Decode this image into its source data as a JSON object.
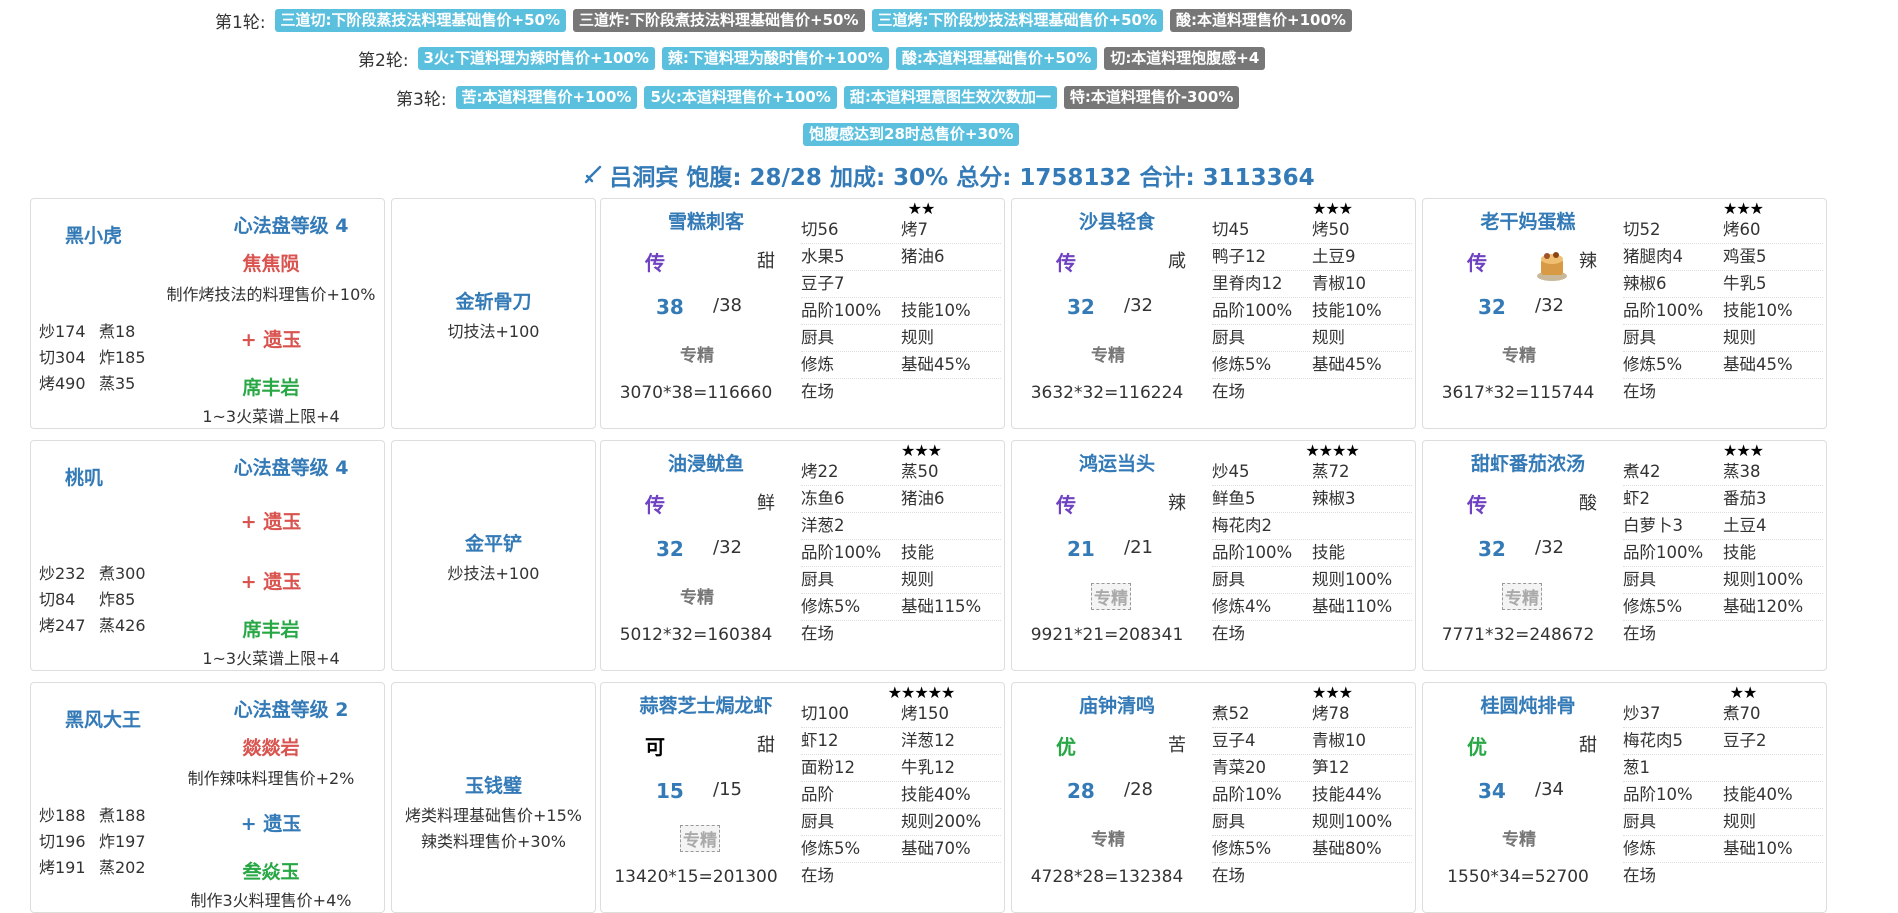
{
  "rounds": [
    {
      "title": "第1轮:",
      "buffs": [
        {
          "text": "三道切:下阶段蒸技法料理基础售价+50%",
          "color": "blue"
        },
        {
          "text": "三道炸:下阶段煮技法料理基础售价+50%",
          "color": "gray"
        },
        {
          "text": "三道烤:下阶段炒技法料理基础售价+50%",
          "color": "blue"
        },
        {
          "text": "酸:本道料理售价+100%",
          "color": "gray"
        }
      ]
    },
    {
      "title": "第2轮:",
      "buffs": [
        {
          "text": "3火:下道料理为辣时售价+100%",
          "color": "blue"
        },
        {
          "text": "辣:下道料理为酸时售价+100%",
          "color": "blue"
        },
        {
          "text": "酸:本道料理基础售价+50%",
          "color": "blue"
        },
        {
          "text": "切:本道料理饱腹感+4",
          "color": "gray"
        }
      ]
    },
    {
      "title": "第3轮:",
      "buffs": [
        {
          "text": "苦:本道料理售价+100%",
          "color": "blue"
        },
        {
          "text": "5火:本道料理售价+100%",
          "color": "blue"
        },
        {
          "text": "甜:本道料理意图生效次数加一",
          "color": "blue"
        },
        {
          "text": "特:本道料理售价-300%",
          "color": "gray"
        }
      ]
    }
  ],
  "extra_buff": "饱腹感达到28时总售价+30%",
  "summary": {
    "icon": "sword-icon",
    "text": "吕洞宾 饱腹: 28/28 加成: 30% 总分: 1758132 合计: 3113364"
  },
  "rows": [
    {
      "chef": {
        "name": "黑小虎",
        "disk": "心法盘等级 4",
        "jade1": "焦焦陨",
        "jade1_desc": "制作烤技法的料理售价+10%",
        "jade2": "+ 遗玉",
        "jade3": "席丰岩",
        "jade3_desc": "1~3火菜谱上限+4",
        "stats": [
          [
            "炒174",
            "煮18"
          ],
          [
            "切304",
            "炸185"
          ],
          [
            "烤490",
            "蒸35"
          ]
        ]
      },
      "equip": {
        "name": "金斩骨刀",
        "skills": [
          "切技法+100"
        ]
      },
      "dishes": [
        {
          "name": "雪糕刺客",
          "rank": "传",
          "rank_color": "purple",
          "taste": "甜",
          "qty": "38",
          "qtymax": "/38",
          "spec": "专精",
          "spec_faded": false,
          "calc": "3070*38=116660",
          "stars": "★★",
          "cake": false,
          "grid": [
            [
              "切56",
              "烤7"
            ],
            [
              "水果5",
              "猪油6"
            ],
            [
              "豆子7",
              ""
            ],
            [
              "品阶100%",
              "技能10%"
            ],
            [
              "厨具",
              "规则"
            ],
            [
              "修炼",
              "基础45%"
            ],
            [
              "在场",
              ""
            ]
          ]
        },
        {
          "name": "沙县轻食",
          "rank": "传",
          "rank_color": "purple",
          "taste": "咸",
          "qty": "32",
          "qtymax": "/32",
          "spec": "专精",
          "spec_faded": false,
          "calc": "3632*32=116224",
          "stars": "★★★",
          "cake": false,
          "grid": [
            [
              "切45",
              "烤50"
            ],
            [
              "鸭子12",
              "土豆9"
            ],
            [
              "里脊肉12",
              "青椒10"
            ],
            [
              "品阶100%",
              "技能10%"
            ],
            [
              "厨具",
              "规则"
            ],
            [
              "修炼5%",
              "基础45%"
            ],
            [
              "在场",
              ""
            ]
          ]
        },
        {
          "name": "老干妈蛋糕",
          "rank": "传",
          "rank_color": "purple",
          "taste": "辣",
          "qty": "32",
          "qtymax": "/32",
          "spec": "专精",
          "spec_faded": false,
          "calc": "3617*32=115744",
          "stars": "★★★",
          "cake": true,
          "grid": [
            [
              "切52",
              "烤60"
            ],
            [
              "猪腿肉4",
              "鸡蛋5"
            ],
            [
              "辣椒6",
              "牛乳5"
            ],
            [
              "品阶100%",
              "技能10%"
            ],
            [
              "厨具",
              "规则"
            ],
            [
              "修炼5%",
              "基础45%"
            ],
            [
              "在场",
              ""
            ]
          ]
        }
      ]
    },
    {
      "chef": {
        "name": "桃叽",
        "disk": "心法盘等级 4",
        "jade1": "",
        "jade1_desc": "",
        "jade1b": "+ 遗玉",
        "jade2": "+ 遗玉",
        "jade3": "席丰岩",
        "jade3_desc": "1~3火菜谱上限+4",
        "stats": [
          [
            "炒232",
            "煮300"
          ],
          [
            "切84",
            "炸85"
          ],
          [
            "烤247",
            "蒸426"
          ]
        ]
      },
      "equip": {
        "name": "金平铲",
        "skills": [
          "炒技法+100"
        ]
      },
      "dishes": [
        {
          "name": "油浸鱿鱼",
          "rank": "传",
          "rank_color": "purple",
          "taste": "鲜",
          "qty": "32",
          "qtymax": "/32",
          "spec": "专精",
          "spec_faded": false,
          "calc": "5012*32=160384",
          "stars": "★★★",
          "cake": false,
          "grid": [
            [
              "烤22",
              "蒸50"
            ],
            [
              "冻鱼6",
              "猪油6"
            ],
            [
              "洋葱2",
              ""
            ],
            [
              "品阶100%",
              "技能"
            ],
            [
              "厨具",
              "规则"
            ],
            [
              "修炼5%",
              "基础115%"
            ],
            [
              "在场",
              ""
            ]
          ]
        },
        {
          "name": "鸿运当头",
          "rank": "传",
          "rank_color": "purple",
          "taste": "辣",
          "qty": "21",
          "qtymax": "/21",
          "spec": "专精",
          "spec_faded": true,
          "calc": "9921*21=208341",
          "stars": "★★★★",
          "cake": false,
          "grid": [
            [
              "炒45",
              "蒸72"
            ],
            [
              "鲜鱼5",
              "辣椒3"
            ],
            [
              "梅花肉2",
              ""
            ],
            [
              "品阶100%",
              "技能"
            ],
            [
              "厨具",
              "规则100%"
            ],
            [
              "修炼4%",
              "基础110%"
            ],
            [
              "在场",
              ""
            ]
          ]
        },
        {
          "name": "甜虾番茄浓汤",
          "rank": "传",
          "rank_color": "purple",
          "taste": "酸",
          "qty": "32",
          "qtymax": "/32",
          "spec": "专精",
          "spec_faded": true,
          "calc": "7771*32=248672",
          "stars": "★★★",
          "cake": false,
          "grid": [
            [
              "煮42",
              "蒸38"
            ],
            [
              "虾2",
              "番茄3"
            ],
            [
              "白萝卜3",
              "土豆4"
            ],
            [
              "品阶100%",
              "技能"
            ],
            [
              "厨具",
              "规则100%"
            ],
            [
              "修炼5%",
              "基础120%"
            ],
            [
              "在场",
              ""
            ]
          ]
        }
      ]
    },
    {
      "chef": {
        "name": "黑风大王",
        "disk": "心法盘等级 2",
        "jade1": "燚燚岩",
        "jade1_desc": "制作辣味料理售价+2%",
        "jade2": "+ 遗玉",
        "jade3": "叁焱玉",
        "jade3_desc": "制作3火料理售价+4%",
        "stats": [
          [
            "炒188",
            "煮188"
          ],
          [
            "切196",
            "炸197"
          ],
          [
            "烤191",
            "蒸202"
          ]
        ]
      },
      "equip": {
        "name": "玉钱璧",
        "skills": [
          "烤类料理基础售价+15%",
          "辣类料理售价+30%"
        ]
      },
      "dishes": [
        {
          "name": "蒜蓉芝士焗龙虾",
          "rank": "可",
          "rank_color": "black",
          "taste": "甜",
          "qty": "15",
          "qtymax": "/15",
          "spec": "专精",
          "spec_faded": true,
          "calc": "13420*15=201300",
          "stars": "★★★★★",
          "cake": false,
          "grid": [
            [
              "切100",
              "烤150"
            ],
            [
              "虾12",
              "洋葱12"
            ],
            [
              "面粉12",
              "牛乳12"
            ],
            [
              "品阶",
              "技能40%"
            ],
            [
              "厨具",
              "规则200%"
            ],
            [
              "修炼5%",
              "基础70%"
            ],
            [
              "在场",
              ""
            ]
          ]
        },
        {
          "name": "庙钟清鸣",
          "rank": "优",
          "rank_color": "green",
          "taste": "苦",
          "qty": "28",
          "qtymax": "/28",
          "spec": "专精",
          "spec_faded": false,
          "calc": "4728*28=132384",
          "stars": "★★★",
          "cake": false,
          "grid": [
            [
              "煮52",
              "烤78"
            ],
            [
              "豆子4",
              "青椒10"
            ],
            [
              "青菜20",
              "笋12"
            ],
            [
              "品阶10%",
              "技能44%"
            ],
            [
              "厨具",
              "规则100%"
            ],
            [
              "修炼5%",
              "基础80%"
            ],
            [
              "在场",
              ""
            ]
          ]
        },
        {
          "name": "桂圆炖排骨",
          "rank": "优",
          "rank_color": "green",
          "taste": "甜",
          "qty": "34",
          "qtymax": "/34",
          "spec": "专精",
          "spec_faded": false,
          "calc": "1550*34=52700",
          "stars": "★★",
          "cake": false,
          "grid": [
            [
              "炒37",
              "煮70"
            ],
            [
              "梅花肉5",
              "豆子2"
            ],
            [
              "葱1",
              ""
            ],
            [
              "品阶10%",
              "技能40%"
            ],
            [
              "厨具",
              "规则"
            ],
            [
              "修炼",
              "基础10%"
            ],
            [
              "在场",
              ""
            ]
          ]
        }
      ]
    }
  ]
}
